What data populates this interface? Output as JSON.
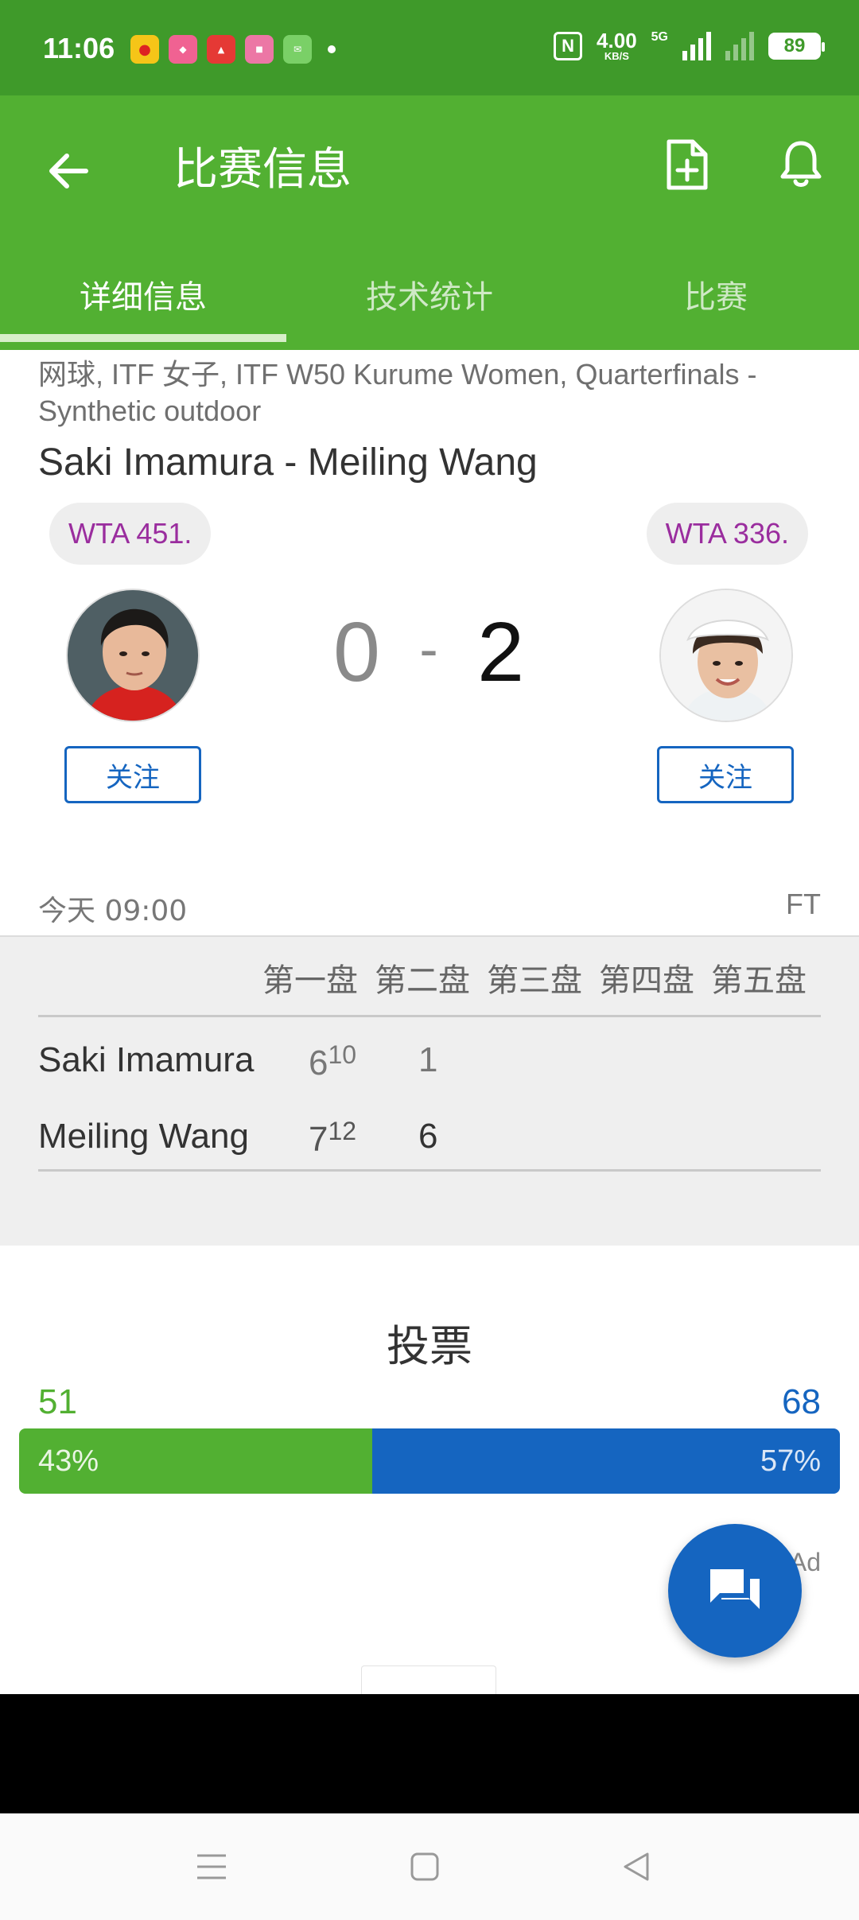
{
  "status_bar": {
    "time": "11:06",
    "notif_icons": [
      "weibo-icon",
      "app-icon",
      "app-icon",
      "app-icon",
      "mail-icon"
    ],
    "net_speed_value": "4.00",
    "net_speed_unit": "KB/S",
    "network": "5G",
    "battery": "89",
    "nfc_label": "N"
  },
  "app_bar": {
    "title": "比赛信息",
    "icons": [
      "back-arrow-icon",
      "add-document-icon",
      "bell-icon"
    ],
    "tabs": [
      {
        "label": "详细信息",
        "active": true
      },
      {
        "label": "技术统计",
        "active": false
      },
      {
        "label": "比赛",
        "active": false
      }
    ]
  },
  "match": {
    "competition": "网球, ITF 女子, ITF W50 Kurume Women, Quarterfinals - Synthetic outdoor",
    "title": "Saki Imamura - Meiling Wang",
    "home": {
      "rank": "WTA 451.",
      "follow_label": "关注",
      "score": "0"
    },
    "away": {
      "rank": "WTA 336.",
      "follow_label": "关注",
      "score": "2"
    },
    "score_separator": "-",
    "time": "今天 09:00",
    "status": "FT"
  },
  "score_table": {
    "headers": [
      "第一盘",
      "第二盘",
      "第三盘",
      "第四盘",
      "第五盘"
    ],
    "rows": [
      {
        "name": "Saki Imamura",
        "set1": "6",
        "set1_tb": "10",
        "set2": "1"
      },
      {
        "name": "Meiling Wang",
        "set1": "7",
        "set1_tb": "12",
        "set2": "6"
      }
    ]
  },
  "vote": {
    "title": "投票",
    "home_count": "51",
    "away_count": "68",
    "home_pct": "43%",
    "away_pct": "57%",
    "home_fraction": 0.43,
    "colors": {
      "home": "#52b032",
      "away": "#1565c0"
    }
  },
  "ad_label": "Ad",
  "colors": {
    "status_bar": "#3f9a2a",
    "app_bar": "#52b032",
    "accent_blue": "#1565c0",
    "rank_text": "#9a2d9e"
  }
}
